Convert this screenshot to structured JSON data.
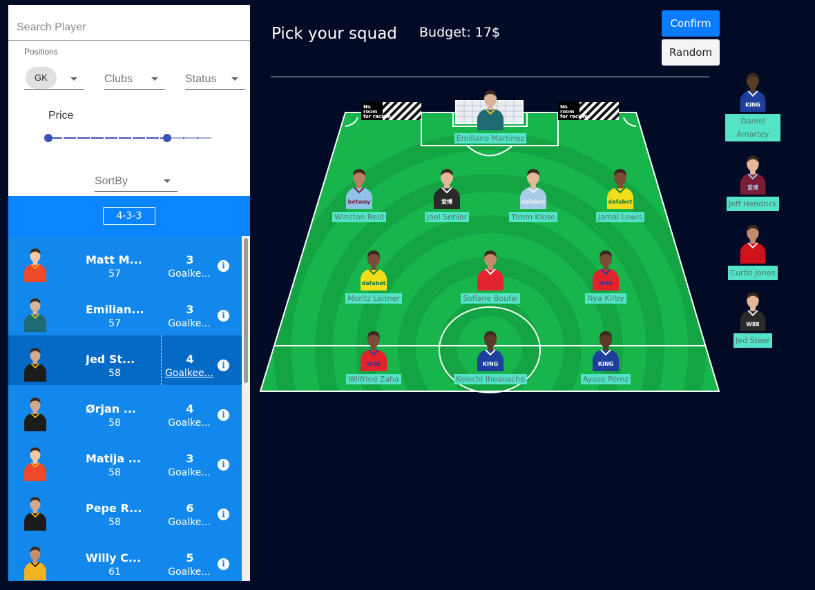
{
  "sidebar": {
    "search_placeholder": "Search Player",
    "positions_label": "Positions",
    "positions_value": "GK",
    "clubs_label": "Clubs",
    "status_label": "Status",
    "price_label": "Price",
    "price_range": [
      0,
      0.73
    ],
    "sortby_label": "SortBy",
    "formation": "4-3-3",
    "players": [
      {
        "name": "Matt M...",
        "price": "57",
        "points": "3",
        "position": "Goalke...",
        "kit": "placeholder",
        "selected": false
      },
      {
        "name": "Emilian...",
        "price": "57",
        "points": "3",
        "position": "Goalke...",
        "kit": "gk-teal",
        "selected": false
      },
      {
        "name": "Jed St...",
        "price": "58",
        "points": "4",
        "position": "Goalkee...",
        "kit": "gk-black",
        "selected": true
      },
      {
        "name": "Ørjan ...",
        "price": "58",
        "points": "4",
        "position": "Goalke...",
        "kit": "gk-black",
        "selected": false
      },
      {
        "name": "Matija ...",
        "price": "58",
        "points": "3",
        "position": "Goalke...",
        "kit": "placeholder",
        "selected": false
      },
      {
        "name": "Pepe R...",
        "price": "58",
        "points": "6",
        "position": "Goalke...",
        "kit": "gk-black",
        "selected": false
      },
      {
        "name": "Willy C...",
        "price": "61",
        "points": "5",
        "position": "Goalke...",
        "kit": "gk-yellow",
        "selected": false
      }
    ],
    "info_glyph": "i"
  },
  "header": {
    "title": "Pick your squad",
    "budget": "Budget:  17$",
    "confirm_label": "Confirm",
    "random_label": "Random"
  },
  "pitch": {
    "banner_text": "No room for racism",
    "goalkeeper": {
      "name": "Emiliano Martínez",
      "kit": "teal"
    },
    "defenders": [
      {
        "name": "Winston Reid",
        "kit": "claret-skyblue",
        "sponsor": "betway"
      },
      {
        "name": "Joel Senior",
        "kit": "black",
        "sponsor": "爱博"
      },
      {
        "name": "Timm Klose",
        "kit": "lightblue",
        "sponsor": "dafabet"
      },
      {
        "name": "Jamal Lewis",
        "kit": "yellow",
        "sponsor": "dafabet"
      }
    ],
    "midfielders": [
      {
        "name": "Moritz Leitner",
        "kit": "yellow",
        "sponsor": "dafabet"
      },
      {
        "name": "Sofiane Boufal",
        "kit": "red-white",
        "sponsor": ""
      },
      {
        "name": "Nya Kirby",
        "kit": "redblue",
        "sponsor": "W88"
      }
    ],
    "forwards": [
      {
        "name": "Wilfried Zaha",
        "kit": "redblue",
        "sponsor": "W88"
      },
      {
        "name": "Kelechi Iheanacho",
        "kit": "blue",
        "sponsor": "KING"
      },
      {
        "name": "Ayoze Pérez",
        "kit": "blue",
        "sponsor": "KING"
      }
    ]
  },
  "bench": [
    {
      "name": "Daniel Amartey",
      "kit": "blue",
      "sponsor": "KING"
    },
    {
      "name": "Jeff Hendrick",
      "kit": "claret",
      "sponsor": "爱博"
    },
    {
      "name": "Curtis Jones",
      "kit": "red",
      "sponsor": ""
    },
    {
      "name": "Jed Steer",
      "kit": "black",
      "sponsor": "W88"
    }
  ],
  "colors": {
    "background": "#020b26",
    "list_blue": "#1388ec",
    "formation_blue": "#0a84ff",
    "pitch_green": "#17b54b",
    "label_bg": "#54e3c6",
    "confirm": "#0a7cff"
  }
}
